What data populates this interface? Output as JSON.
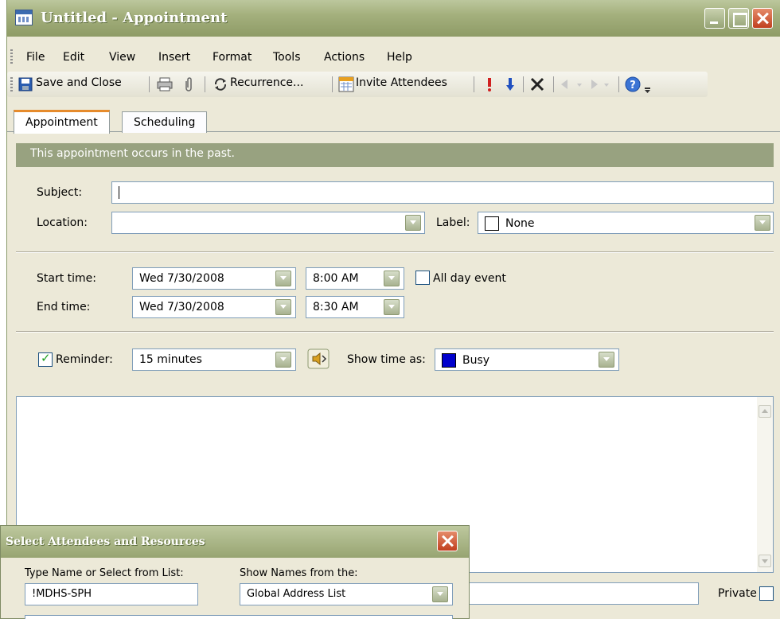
{
  "window": {
    "title": "Untitled - Appointment"
  },
  "menu": [
    "File",
    "Edit",
    "View",
    "Insert",
    "Format",
    "Tools",
    "Actions",
    "Help"
  ],
  "toolbar": {
    "save_close": "Save and Close",
    "recurrence": "Recurrence...",
    "invite": "Invite Attendees"
  },
  "tabs": [
    "Appointment",
    "Scheduling"
  ],
  "info_banner": "This appointment occurs in the past.",
  "form": {
    "subject_label": "Subject:",
    "subject_value": "",
    "location_label": "Location:",
    "location_value": "",
    "label_label": "Label:",
    "label_value": "None",
    "start_label": "Start time:",
    "start_date": "Wed 7/30/2008",
    "start_time": "8:00 AM",
    "end_label": "End time:",
    "end_date": "Wed 7/30/2008",
    "end_time": "8:30 AM",
    "all_day_label": "All day event",
    "all_day_checked": false,
    "reminder_label": "Reminder:",
    "reminder_checked": true,
    "reminder_value": "15 minutes",
    "show_time_label": "Show time as:",
    "show_time_value": "Busy",
    "show_time_color": "#0000cc",
    "private_label": "Private",
    "private_checked": false
  },
  "dialog": {
    "title": "Select Attendees and Resources",
    "type_name_label": "Type Name or Select from List:",
    "type_name_value": "!MDHS-SPH",
    "show_names_label": "Show Names from the:",
    "show_names_value": "Global Address List"
  },
  "colors": {
    "titlebar": "#a4b07d",
    "info_banner": "#98a280",
    "tab_accent": "#e68b2c"
  }
}
